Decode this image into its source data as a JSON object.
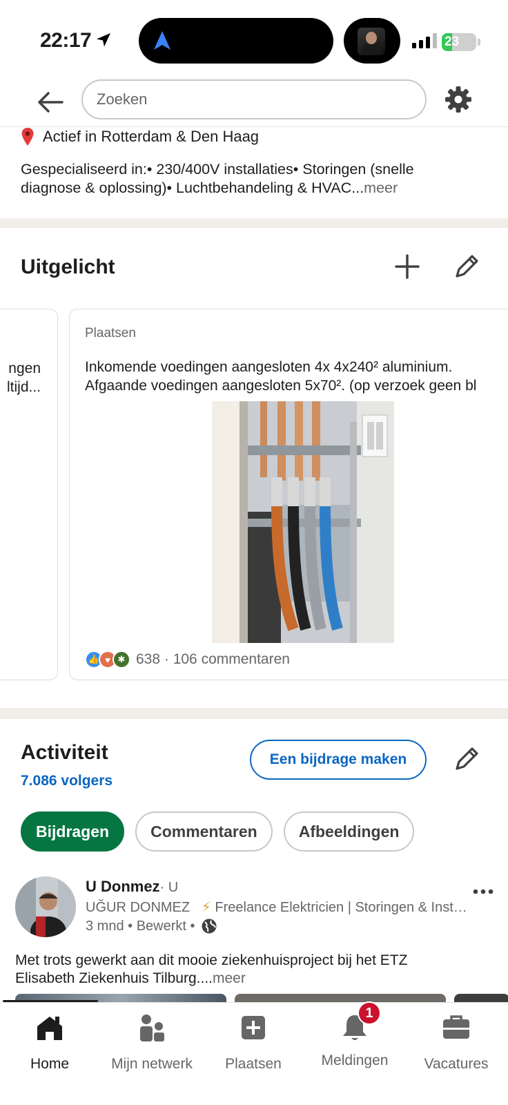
{
  "status_bar": {
    "time": "22:17",
    "battery": "23"
  },
  "top_nav": {
    "search_placeholder": "Zoeken"
  },
  "intro": {
    "location": "Actief in Rotterdam & Den Haag",
    "about_line1": "Gespecialiseerd in:• 230/400V installaties• Storingen (snelle",
    "about_line2": "diagnose & oplossing)• Luchtbehandeling & HVAC",
    "about_ellipsis": "...",
    "about_more": "meer"
  },
  "featured": {
    "title": "Uitgelicht",
    "prev_card_line1": "ngen",
    "prev_card_line2": "ltijd...",
    "card": {
      "type_label": "Plaatsen",
      "text_line1": "Inkomende voedingen aangesloten 4x 4x240² aluminium.",
      "text_line2": "Afgaande voedingen aangesloten 5x70². (op verzoek geen bl",
      "reactions": "638 · 106 commentaren"
    }
  },
  "activity": {
    "title": "Activiteit",
    "followers": "7.086 volgers",
    "contribute_label": "Een bijdrage maken",
    "tabs": [
      "Bijdragen",
      "Commentaren",
      "Afbeeldingen"
    ],
    "post": {
      "author": "U Donmez",
      "degree": "· U",
      "headline_name": "UĞUR DONMEZ",
      "headline_rest": "Freelance Elektricien | Storingen & Installaties",
      "meta": "3 mnd • Bewerkt •",
      "body_line1": "Met trots gewerkt aan dit mooie ziekenhuisproject bij het ETZ",
      "body_line2": "Elisabeth Ziekenhuis Tilburg....",
      "body_more": "meer"
    }
  },
  "bottom_nav": {
    "items": [
      {
        "label": "Home"
      },
      {
        "label": "Mijn netwerk"
      },
      {
        "label": "Plaatsen"
      },
      {
        "label": "Meldingen",
        "badge": "1"
      },
      {
        "label": "Vacatures"
      }
    ]
  },
  "colors": {
    "brand_blue": "#0a66c2",
    "active_green": "#057642",
    "badge_red": "#cb112d",
    "section_gap": "#f1eee9"
  }
}
